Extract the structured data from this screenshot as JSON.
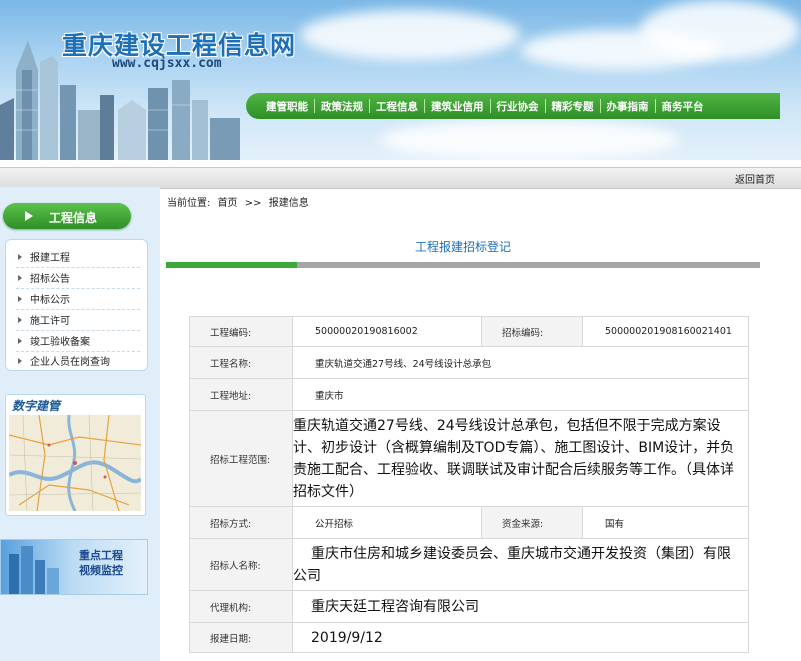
{
  "header": {
    "site_title": "重庆建设工程信息网",
    "site_url": "www.cqjsxx.com",
    "nav": [
      "建管职能",
      "政策法规",
      "工程信息",
      "建筑业信用",
      "行业协会",
      "精彩专题",
      "办事指南",
      "商务平台"
    ]
  },
  "topbar": {
    "back_home": "返回首页"
  },
  "sidebar": {
    "section_title": "工程信息",
    "items": [
      "报建工程",
      "招标公告",
      "中标公示",
      "施工许可",
      "竣工验收备案",
      "企业人员在岗查询"
    ],
    "digital_title": "数字建管",
    "monitor_line1": "重点工程",
    "monitor_line2": "视频监控"
  },
  "breadcrumb": {
    "prefix": "当前位置:",
    "home": "首页",
    "sep": ">>",
    "current": "报建信息"
  },
  "main": {
    "heading": "工程报建招标登记",
    "progress_fraction": 0.22,
    "progress_color": "#3aa93a"
  },
  "record": {
    "project_code_label": "工程编码:",
    "project_code": "500000201908160 02",
    "tender_code_label": "招标编码:",
    "tender_code": "500000201908160021401",
    "project_name_label": "工程名称:",
    "project_name": "重庆轨道交通27号线、24号线设计总承包",
    "address_label": "工程地址:",
    "address": "重庆市",
    "scope_label": "招标工程范围:",
    "scope": "重庆轨道交通27号线、24号线设计总承包，包括但不限于完成方案设计、初步设计（含概算编制及TOD专篇）、施工图设计、BIM设计，并负责施工配合、工程验收、联调联试及审计配合后续服务等工作。（具体详招标文件）",
    "method_label": "招标方式:",
    "method": "公开招标",
    "fund_label": "资金来源:",
    "fund": "国有",
    "tenderer_label": "招标人名称:",
    "tenderer": "重庆市住房和城乡建设委员会、重庆城市交通开发投资（集团）有限公司",
    "agency_label": "代理机构:",
    "agency": "重庆天廷工程咨询有限公司",
    "date_label": "报建日期:",
    "date": "2019/9/12"
  }
}
